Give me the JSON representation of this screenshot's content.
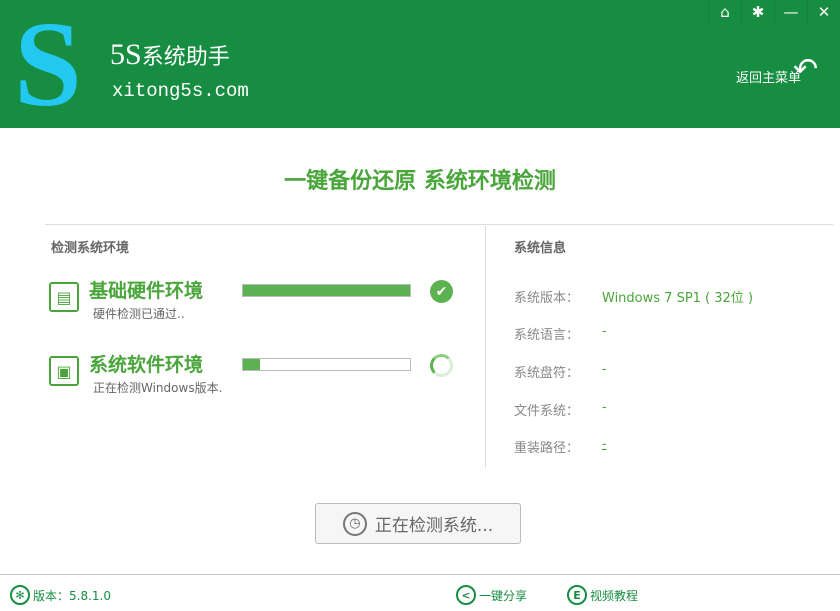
{
  "header": {
    "logo_letter": "S",
    "brand": "5S",
    "brand_cn": "系统助手",
    "domain": "xitong5s.com",
    "back_label": "返回主菜单"
  },
  "window": {
    "home": "⌂",
    "settings": "✱",
    "minimize": "—",
    "close": "✕"
  },
  "title": "一键备份还原  系统环境检测",
  "left": {
    "heading": "检测系统环境",
    "items": [
      {
        "title": "基础硬件环境",
        "sub": "硬件检测已通过..",
        "progress": 100,
        "status": "done"
      },
      {
        "title": "系统软件环境",
        "sub": "正在检测Windows版本.",
        "progress": 10,
        "status": "running"
      }
    ]
  },
  "right": {
    "heading": "系统信息",
    "rows": [
      {
        "label": "系统版本：",
        "value": "Windows 7 SP1 ( 32位 )"
      },
      {
        "label": "系统语言：",
        "value": "-"
      },
      {
        "label": "系统盘符：",
        "value": "-"
      },
      {
        "label": "文件系统：",
        "value": "-"
      },
      {
        "label": "重装路径：",
        "value": "-"
      }
    ]
  },
  "button": {
    "label": "正在检测系统..."
  },
  "footer": {
    "version": "版本：5.8.1.0",
    "share": "一键分享",
    "video": "视频教程"
  }
}
